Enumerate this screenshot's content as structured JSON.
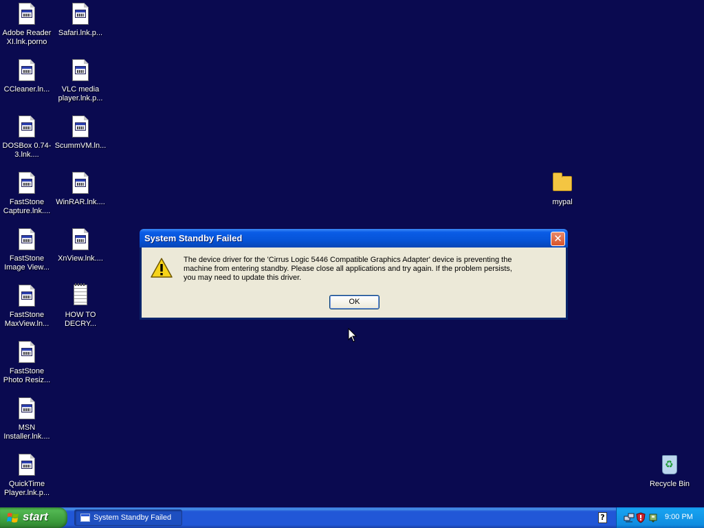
{
  "desktop": {
    "icons": [
      {
        "label": "Adobe Reader XI.lnk.porno",
        "icon": "shortcut-file-icon"
      },
      {
        "label": "Safari.lnk.p...",
        "icon": "shortcut-file-icon"
      },
      {
        "label": "CCleaner.ln...",
        "icon": "shortcut-file-icon"
      },
      {
        "label": "VLC media player.lnk.p...",
        "icon": "shortcut-file-icon"
      },
      {
        "label": "DOSBox 0.74-3.lnk....",
        "icon": "shortcut-file-icon"
      },
      {
        "label": "ScummVM.ln...",
        "icon": "shortcut-file-icon"
      },
      {
        "label": "FastStone Capture.lnk....",
        "icon": "shortcut-file-icon"
      },
      {
        "label": "WinRAR.lnk....",
        "icon": "shortcut-file-icon"
      },
      {
        "label": "FastStone Image View...",
        "icon": "shortcut-file-icon"
      },
      {
        "label": "XnView.lnk....",
        "icon": "shortcut-file-icon"
      },
      {
        "label": "FastStone MaxView.ln...",
        "icon": "shortcut-file-icon"
      },
      {
        "label": "HOW TO DECRY...",
        "icon": "text-document-icon"
      },
      {
        "label": "FastStone Photo Resiz...",
        "icon": "shortcut-file-icon"
      },
      {
        "label": "MSN Installer.lnk....",
        "icon": "shortcut-file-icon"
      },
      {
        "label": "QuickTime Player.lnk.p...",
        "icon": "shortcut-file-icon"
      },
      {
        "label": "mypal",
        "icon": "folder-icon"
      },
      {
        "label": "Recycle Bin",
        "icon": "recycle-bin-icon"
      }
    ]
  },
  "dialog": {
    "title": "System Standby Failed",
    "close_glyph": "✕",
    "icon": "warning-icon",
    "message": "The device driver for the 'Cirrus Logic 5446 Compatible Graphics Adapter' device is preventing the machine from entering standby. Please close all applications and try again. If the problem persists, you may need to update this driver.",
    "ok_label": "OK"
  },
  "taskbar": {
    "start_label": "start",
    "task_item": "System Standby Failed",
    "help_glyph": "?",
    "clock": "9:00 PM"
  },
  "colors": {
    "desktop_background": "#0a0a50",
    "taskbar_blue": "#2157d7",
    "start_green": "#3a9a3a",
    "tray_blue": "#0f8ce0"
  }
}
